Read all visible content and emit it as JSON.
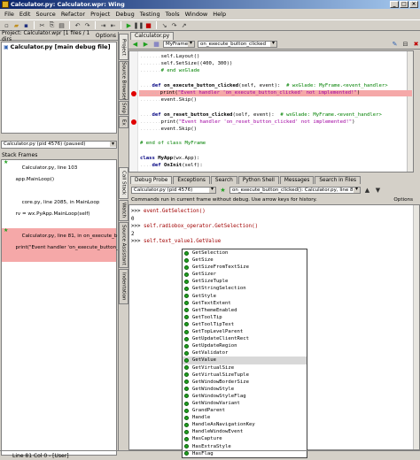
{
  "window": {
    "title": "Calculator.py: Calculator.wpr: Wing",
    "controls": [
      "_",
      "□",
      "×"
    ]
  },
  "menu": [
    "File",
    "Edit",
    "Source",
    "Refactor",
    "Project",
    "Debug",
    "Testing",
    "Tools",
    "Window",
    "Help"
  ],
  "project": {
    "header": "Project: Calculator.wpr [1 files / 1 dirs",
    "options_label": "Options",
    "files": [
      "Calculator.py [main debug file]"
    ]
  },
  "left_vtabs": [
    "Project",
    "Source Browser",
    "Snip",
    "Ex"
  ],
  "stack": {
    "process": "Calculator.py (pid 4576) (paused)",
    "header": "Stack Frames",
    "frames": [
      [
        "Calculator.py, line 103",
        "  app.MainLoop()"
      ],
      [
        "core.py, line 2085, in MainLoop",
        "  rv = wx.PyApp.MainLoop(self)"
      ],
      [
        "Calculator.py, line 81, in on_execute_button_clicked",
        "  print(\"Event handler 'on_execute_button_clicked'"
      ]
    ]
  },
  "mid_vtabs": [
    "Call Stack",
    "Watch",
    "Source Assistant",
    "Indentation"
  ],
  "editor": {
    "tab": "Calculator.py",
    "class_combo": "MyFrame",
    "method_combo": "on_execute_button_clicked",
    "lines": [
      {
        "indent": ".......",
        "parts": [
          [
            "",
            "self.Layout()"
          ]
        ]
      },
      {
        "indent": ".......",
        "parts": [
          [
            "",
            "self.SetSize((400, 300))"
          ]
        ]
      },
      {
        "indent": ".......",
        "parts": [
          [
            "cmt",
            "# end wxGlade"
          ]
        ]
      },
      {
        "indent": "",
        "parts": []
      },
      {
        "indent": "....",
        "parts": [
          [
            "kw",
            "def "
          ],
          [
            "fn",
            "on_execute_button_clicked"
          ],
          [
            "",
            "(self, event):  "
          ],
          [
            "cmt",
            "# wxGlade: MyFrame.<event_handler>"
          ]
        ]
      },
      {
        "indent": ".......",
        "parts": [
          [
            "",
            "print("
          ],
          [
            "str",
            "\"Event handler 'on_execute_button_clicked' not implemented!\""
          ],
          [
            "",
            ")"
          ]
        ],
        "highlight": true,
        "breakpoint": true
      },
      {
        "indent": ".......",
        "parts": [
          [
            "",
            "event.Skip()"
          ]
        ]
      },
      {
        "indent": "",
        "parts": []
      },
      {
        "indent": "....",
        "parts": [
          [
            "kw",
            "def "
          ],
          [
            "fn",
            "on_reset_button_clicked"
          ],
          [
            "",
            "(self, event):  "
          ],
          [
            "cmt",
            "# wxGlade: MyFrame.<event_handler>"
          ]
        ]
      },
      {
        "indent": ".......",
        "parts": [
          [
            "",
            "print("
          ],
          [
            "str",
            "\"Event handler 'on_reset_button_clicked' not implemented!\""
          ],
          [
            "",
            ")"
          ]
        ],
        "breakpoint": true
      },
      {
        "indent": ".......",
        "parts": [
          [
            "",
            "event.Skip()"
          ]
        ]
      },
      {
        "indent": "",
        "parts": []
      },
      {
        "indent": "",
        "parts": [
          [
            "cmt",
            "# end of class MyFrame"
          ]
        ]
      },
      {
        "indent": "",
        "parts": []
      },
      {
        "indent": "",
        "parts": [
          [
            "kw",
            "class "
          ],
          [
            "fn",
            "MyApp"
          ],
          [
            "",
            "(wx.App):"
          ]
        ]
      },
      {
        "indent": "....",
        "parts": [
          [
            "kw",
            "def "
          ],
          [
            "fn",
            "OnInit"
          ],
          [
            "",
            "(self):"
          ]
        ]
      }
    ]
  },
  "debug_tabs": [
    "Debug Probe",
    "Exceptions",
    "Search",
    "Python Shell",
    "Messages",
    "Search in Files"
  ],
  "probe": {
    "process_combo": "Calculator.py (pid 4576)",
    "frame_combo": "on_execute_button_clicked(): Calculator.py, line 81",
    "hint": "Commands run in current frame without debug. Use arrow keys for history.",
    "options_label": "Options",
    "lines": [
      [
        ">>> ",
        "event.GetSelection()"
      ],
      [
        "",
        "0"
      ],
      [
        ">>> ",
        "self.radiobox_operator.GetSelection()"
      ],
      [
        "",
        "2"
      ],
      [
        ">>> ",
        "self.text_value1.GetValue"
      ]
    ]
  },
  "autocomplete": {
    "selected": "GetValue",
    "items": [
      "GetSelection",
      "GetSize",
      "GetSizeFromTextSize",
      "GetSizer",
      "GetSizeTuple",
      "GetStringSelection",
      "GetStyle",
      "GetTextExtent",
      "GetThemeEnabled",
      "GetToolTip",
      "GetToolTipText",
      "GetTopLevelParent",
      "GetUpdateClientRect",
      "GetUpdateRegion",
      "GetValidator",
      "GetValue",
      "GetVirtualSize",
      "GetVirtualSizeTuple",
      "GetWindowBorderSize",
      "GetWindowStyle",
      "GetWindowStyleFlag",
      "GetWindowVariant",
      "GrandParent",
      "Handle",
      "HandleAsNavigationKey",
      "HandleWindowEvent",
      "HasCapture",
      "HasExtraStyle",
      "HasFlag",
      "HasFocus"
    ]
  },
  "status": {
    "text": "Line 81 Col 0 - [User]"
  }
}
